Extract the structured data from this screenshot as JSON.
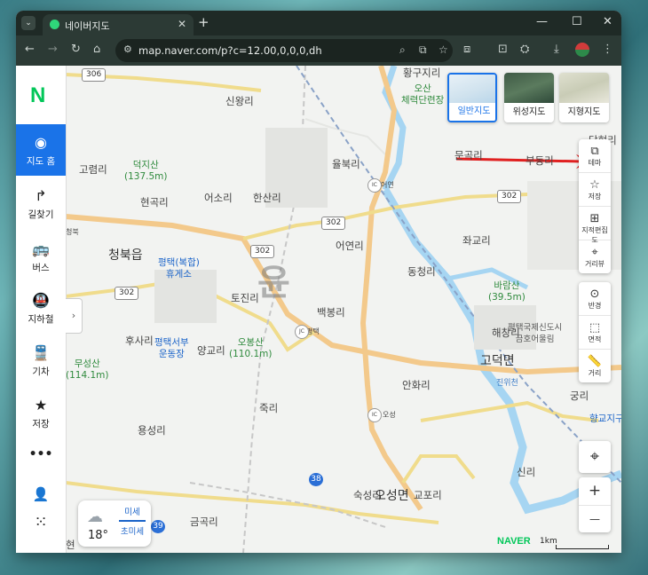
{
  "browser": {
    "tab_title": "네이버지도",
    "tab_close": "✕",
    "tab_menu": "⌄",
    "new_tab": "+",
    "url": "map.naver.com/p?c=12.00,0,0,0,dh",
    "win_controls": {
      "minimize": "—",
      "maximize": "☐",
      "close": "✕"
    }
  },
  "sidebar": {
    "logo": "N",
    "items": [
      {
        "label": "지도 홈",
        "icon": "map-pin-icon",
        "glyph": "◉",
        "active": true
      },
      {
        "label": "길찾기",
        "icon": "directions-icon",
        "glyph": "↱"
      },
      {
        "label": "버스",
        "icon": "bus-icon",
        "glyph": "🚌"
      },
      {
        "label": "지하철",
        "icon": "subway-icon",
        "glyph": "🚇"
      },
      {
        "label": "기차",
        "icon": "train-icon",
        "glyph": "🚆"
      },
      {
        "label": "저장",
        "icon": "star-icon",
        "glyph": "★"
      },
      {
        "label": "•••",
        "icon": "more-icon",
        "glyph": ""
      }
    ],
    "user_glyph": "👤",
    "apps_glyph": "⁙"
  },
  "map_types": [
    {
      "label": "일반지도",
      "active": true
    },
    {
      "label": "위성지도",
      "active": false
    },
    {
      "label": "지형지도",
      "active": false
    }
  ],
  "map_tools": [
    {
      "label": "테마",
      "icon": "theme-icon",
      "glyph": "⧉"
    },
    {
      "label": "저장",
      "icon": "bookmark-star-icon",
      "glyph": "☆"
    },
    {
      "label": "지적편집도",
      "icon": "cadastral-icon",
      "glyph": "⊞"
    },
    {
      "label": "거리뷰",
      "icon": "street-view-icon",
      "glyph": "⌖"
    },
    {
      "label": "반경",
      "icon": "radius-icon",
      "glyph": "⊙"
    },
    {
      "label": "면적",
      "icon": "area-icon",
      "glyph": "⬚"
    },
    {
      "label": "거리",
      "icon": "ruler-icon",
      "glyph": "📏"
    }
  ],
  "locate_glyph": "⌖",
  "zoom": {
    "in": "+",
    "out": "—"
  },
  "places": {
    "p1": "황구지리",
    "p2": "오산\n체력단련장",
    "p3": "당현리",
    "p4": "신왕리",
    "p5": "문곡리",
    "p6": "율북리",
    "p7": "고렴리",
    "p8": "덕지산\n(137.5m)",
    "p9": "현곡리",
    "p10": "어소리",
    "p11": "한산리",
    "p12": "어연",
    "p13": "부동리",
    "p14": "청북",
    "p15": "청북읍",
    "p16": "어연리",
    "p17": "좌교리",
    "p18": "평택(복합)\n휴게소",
    "p19": "동청리",
    "p20": "토진리",
    "p21": "바람산\n(39.5m)",
    "p22": "백봉리",
    "p23": "평택",
    "p24": "후사리",
    "p25": "평택서부\n운동장",
    "p26": "오봉산\n(110.1m)",
    "p27": "양교리",
    "p28": "해창리",
    "p29": "평택국제신도시\n금호어울림",
    "p30": "무성산\n(114.1m)",
    "p31": "고덕면",
    "p32": "안화리",
    "p33": "진위천",
    "p34": "궁리",
    "p35": "오성",
    "p36": "죽리",
    "p37": "용성리",
    "p38": "향교지구",
    "p39": "신리",
    "p40": "숙성리",
    "p41": "오성면",
    "p42": "교포리",
    "p43": "금곡리",
    "p44": "현"
  },
  "roads": {
    "r306": "306",
    "r302a": "302",
    "r302b": "302",
    "r302c": "302",
    "r302d": "302",
    "r38": "38",
    "r39": "39",
    "ic": "IC",
    "jc": "JC"
  },
  "watermark": "윤",
  "weather": {
    "temp": "18°",
    "dust1": "미세",
    "dust2": "초미세",
    "icon": "cloud-icon"
  },
  "naver_brand": "NAVER",
  "scale_text": "1km",
  "colors": {
    "accent": "#1a73e8",
    "naver_green": "#03c75a",
    "highway": "#f3c98b",
    "water": "#a6d5f2",
    "annotation_arrow": "#e02020"
  }
}
